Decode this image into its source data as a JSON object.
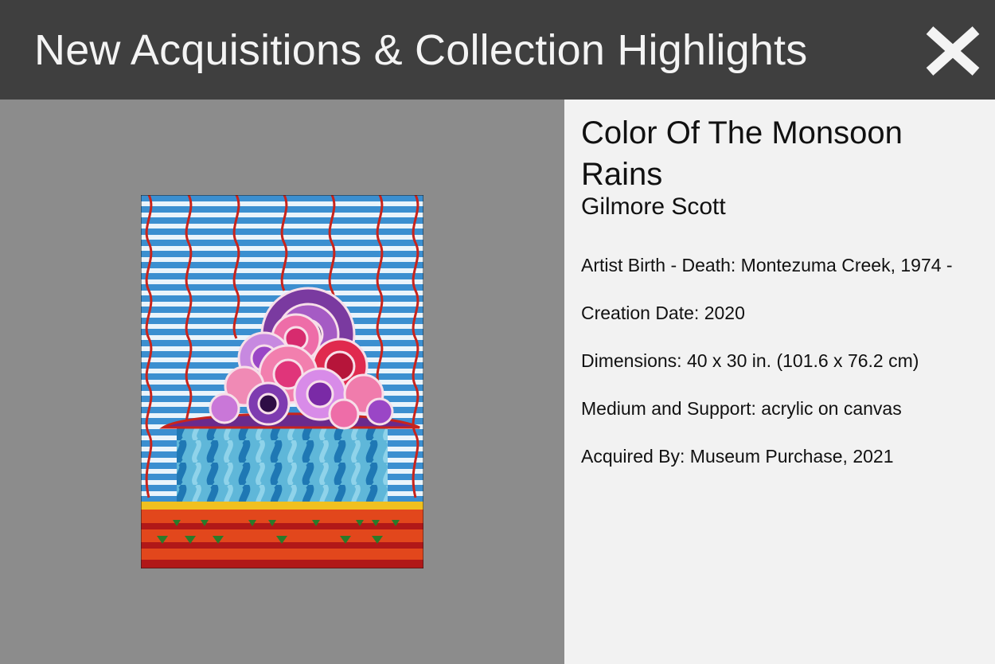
{
  "header": {
    "title": "New Acquisitions & Collection Highlights",
    "close_icon": "close-x-icon"
  },
  "artwork": {
    "title": "Color Of The Monsoon Rains",
    "artist": "Gilmore Scott",
    "details": [
      {
        "label": "Artist Birth - Death",
        "value": "Montezuma Creek, 1974 -"
      },
      {
        "label": "Creation Date",
        "value": "2020"
      },
      {
        "label": "Dimensions",
        "value": "40 x 30 in. (101.6 x 76.2 cm)"
      },
      {
        "label": "Medium and Support",
        "value": "acrylic on canvas"
      },
      {
        "label": "Acquired By",
        "value": "Museum Purchase, 2021"
      }
    ]
  },
  "colors": {
    "header_bg": "#3f3f3f",
    "viewer_bg": "#8c8c8c",
    "info_bg": "#f2f2f2"
  }
}
